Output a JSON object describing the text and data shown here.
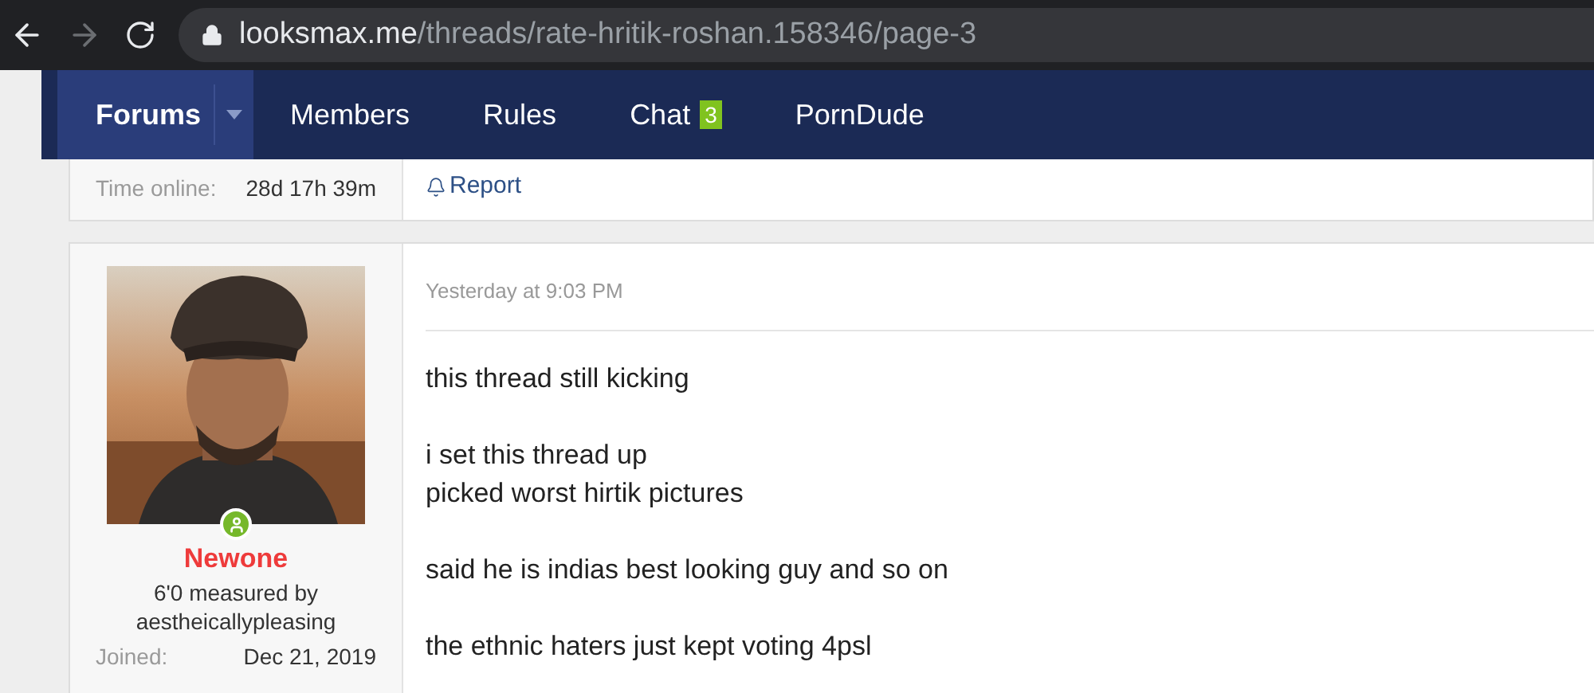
{
  "browser": {
    "url_host": "looksmax.me",
    "url_path": "/threads/rate-hritik-roshan.158346/page-3"
  },
  "nav": {
    "items": [
      {
        "label": "Forums",
        "selected": true,
        "has_menu": true
      },
      {
        "label": "Members",
        "selected": false
      },
      {
        "label": "Rules",
        "selected": false
      },
      {
        "label": "Chat",
        "selected": false,
        "badge": "3"
      },
      {
        "label": "PornDude",
        "selected": false
      }
    ]
  },
  "previous_post": {
    "stats": [
      {
        "label": "Time online:",
        "value": "28d 17h 39m"
      }
    ],
    "actions": [
      "Report"
    ]
  },
  "post": {
    "author": {
      "online": true,
      "name": "Newone",
      "title": "6'0 measured by aestheicallypleasing",
      "stats": [
        {
          "label": "Joined:",
          "value": "Dec 21, 2019"
        }
      ]
    },
    "time": "Yesterday at 9:03 PM",
    "paragraphs": [
      [
        "this thread still kicking"
      ],
      [
        "i set this thread up",
        "picked worst hirtik pictures"
      ],
      [
        "said he is indias best looking guy and so on"
      ],
      [
        "the ethnic haters just kept voting 4psl"
      ]
    ]
  }
}
